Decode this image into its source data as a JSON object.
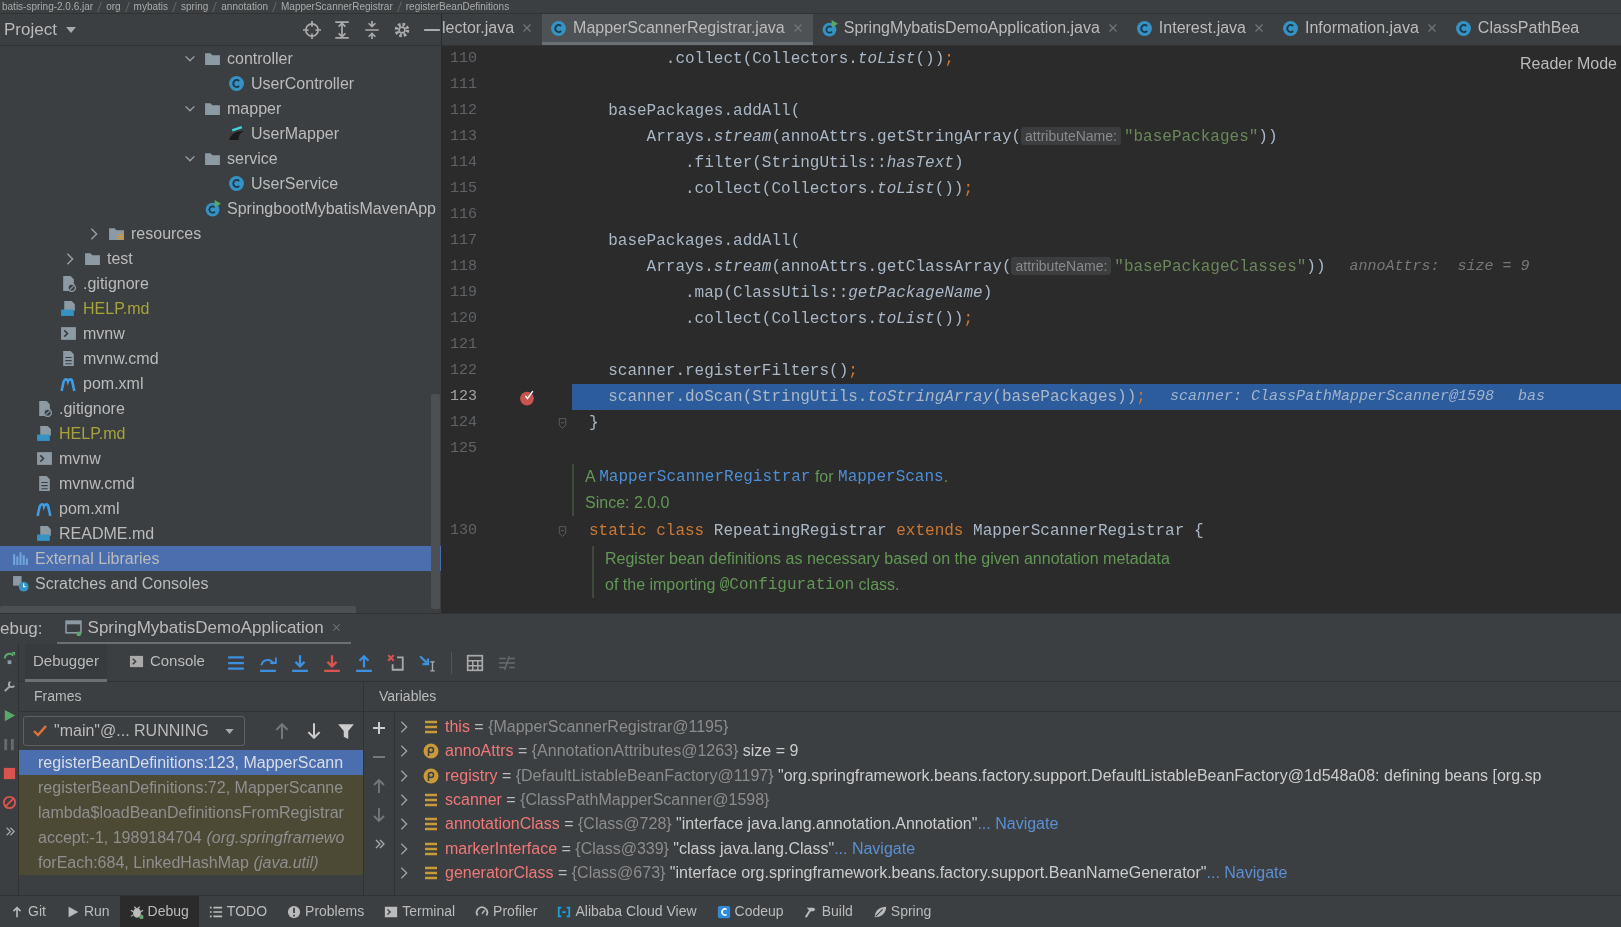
{
  "breadcrumbs": [
    "batis-spring-2.0.6.jar",
    "org",
    "mybatis",
    "spring",
    "annotation",
    "MapperScannerRegistrar",
    "registerBeanDefinitions"
  ],
  "project_panel": {
    "title": "Project",
    "tools": [
      {
        "kind": "locate"
      },
      {
        "kind": "expand"
      },
      {
        "kind": "collapse"
      },
      {
        "kind": "settings"
      },
      {
        "kind": "hide"
      }
    ]
  },
  "tree": [
    {
      "children": [
        {
          "children": [
            {
              "children": [
                {
                  "children": [
                    {
                      "children": [
                        {
                          "children": [
                            {
                              "children": [
                                {
                                  "children": [
                                    {
                                      "label": "controller",
                                      "kind": "folder",
                                      "expanded": true,
                                      "selected": false,
                                      "ignored": false,
                                      "children": [
                                        {
                                          "label": "UserController",
                                          "kind": "class",
                                          "selected": false,
                                          "ignored": false
                                        }
                                      ]
                                    },
                                    {
                                      "label": "mapper",
                                      "kind": "folder",
                                      "expanded": true,
                                      "selected": false,
                                      "ignored": false,
                                      "children": [
                                        {
                                          "label": "UserMapper",
                                          "kind": "mapper",
                                          "selected": false,
                                          "ignored": false
                                        }
                                      ]
                                    },
                                    {
                                      "label": "service",
                                      "kind": "folder",
                                      "expanded": true,
                                      "selected": false,
                                      "ignored": false,
                                      "children": [
                                        {
                                          "label": "UserService",
                                          "kind": "class",
                                          "selected": false,
                                          "ignored": false
                                        }
                                      ]
                                    },
                                    {
                                      "label": "SpringbootMybatisMavenApp",
                                      "kind": "app",
                                      "selected": false,
                                      "ignored": false
                                    }
                                  ]
                                }
                              ]
                            }
                          ]
                        }
                      ]
                    },
                    {
                      "label": "resources",
                      "kind": "resources",
                      "expanded": false,
                      "selected": false,
                      "ignored": false
                    }
                  ]
                },
                {
                  "label": "test",
                  "kind": "folder",
                  "expanded": false,
                  "selected": false,
                  "ignored": false
                }
              ]
            },
            {
              "label": ".gitignore",
              "kind": "ignore",
              "selected": false,
              "ignored": false
            },
            {
              "label": "HELP.md",
              "kind": "markdown",
              "selected": false,
              "ignored": true
            },
            {
              "label": "mvnw",
              "kind": "script",
              "selected": false,
              "ignored": false
            },
            {
              "label": "mvnw.cmd",
              "kind": "text",
              "selected": false,
              "ignored": false
            },
            {
              "label": "pom.xml",
              "kind": "maven",
              "selected": false,
              "ignored": false
            }
          ]
        },
        {
          "label": ".gitignore",
          "kind": "ignore",
          "selected": false,
          "ignored": false
        },
        {
          "label": "HELP.md",
          "kind": "markdown",
          "selected": false,
          "ignored": true
        },
        {
          "label": "mvnw",
          "kind": "script",
          "selected": false,
          "ignored": false
        },
        {
          "label": "mvnw.cmd",
          "kind": "text",
          "selected": false,
          "ignored": false
        },
        {
          "label": "pom.xml",
          "kind": "maven",
          "selected": false,
          "ignored": false
        },
        {
          "label": "README.md",
          "kind": "markdown",
          "selected": false,
          "ignored": false
        }
      ]
    },
    {
      "label": "External Libraries",
      "kind": "libraries",
      "selected": true,
      "ignored": false
    },
    {
      "label": "Scratches and Consoles",
      "kind": "scratches",
      "selected": false,
      "ignored": false
    }
  ],
  "editor_tabs": [
    {
      "label": "lector.java",
      "kind": "cut",
      "selected": false,
      "closable": true
    },
    {
      "label": "MapperScannerRegistrar.java",
      "kind": "class",
      "selected": true,
      "closable": true
    },
    {
      "label": "SpringMybatisDemoApplication.java",
      "kind": "app",
      "selected": false,
      "closable": true
    },
    {
      "label": "Interest.java",
      "kind": "class",
      "selected": false,
      "closable": true
    },
    {
      "label": "Information.java",
      "kind": "class",
      "selected": false,
      "closable": true
    },
    {
      "label": "ClassPathBea",
      "kind": "class",
      "selected": false,
      "closable": false
    }
  ],
  "reader_mode": "Reader Mode",
  "lines": [
    {
      "kind": "code",
      "number": "110",
      "current": false,
      "breakpoint": false,
      "fold": false,
      "tokens": [
        {
          "kind": "plain",
          "text": "        .collect(Collectors."
        },
        {
          "kind": "italic",
          "text": "toList"
        },
        {
          "kind": "plain",
          "text": "())"
        },
        {
          "kind": "keyword",
          "text": ";"
        }
      ]
    },
    {
      "kind": "code",
      "number": "111",
      "current": false,
      "breakpoint": false,
      "fold": false
    },
    {
      "kind": "code",
      "number": "112",
      "current": false,
      "breakpoint": false,
      "fold": false,
      "tokens": [
        {
          "kind": "plain",
          "text": "  basePackages.addAll("
        }
      ]
    },
    {
      "kind": "code",
      "number": "113",
      "current": false,
      "breakpoint": false,
      "fold": false,
      "tokens": [
        {
          "kind": "plain",
          "text": "      Arrays."
        },
        {
          "kind": "italic",
          "text": "stream"
        },
        {
          "kind": "plain",
          "text": "(annoAttrs.getStringArray("
        },
        {
          "kind": "hint",
          "text": "attributeName:"
        },
        {
          "kind": "string",
          "text": "\"basePackages\""
        },
        {
          "kind": "plain",
          "text": "))"
        }
      ]
    },
    {
      "kind": "code",
      "number": "114",
      "current": false,
      "breakpoint": false,
      "fold": false,
      "tokens": [
        {
          "kind": "plain",
          "text": "          .filter(StringUtils::"
        },
        {
          "kind": "italic",
          "text": "hasText"
        },
        {
          "kind": "plain",
          "text": ")"
        }
      ]
    },
    {
      "kind": "code",
      "number": "115",
      "current": false,
      "breakpoint": false,
      "fold": false,
      "tokens": [
        {
          "kind": "plain",
          "text": "          .collect(Collectors."
        },
        {
          "kind": "italic",
          "text": "toList"
        },
        {
          "kind": "plain",
          "text": "())"
        },
        {
          "kind": "keyword",
          "text": ";"
        }
      ]
    },
    {
      "kind": "code",
      "number": "116",
      "current": false,
      "breakpoint": false,
      "fold": false
    },
    {
      "kind": "code",
      "number": "117",
      "current": false,
      "breakpoint": false,
      "fold": false,
      "tokens": [
        {
          "kind": "plain",
          "text": "  basePackages.addAll("
        }
      ]
    },
    {
      "kind": "code",
      "number": "118",
      "current": false,
      "breakpoint": false,
      "fold": false,
      "tokens": [
        {
          "kind": "plain",
          "text": "      Arrays."
        },
        {
          "kind": "italic",
          "text": "stream"
        },
        {
          "kind": "plain",
          "text": "(annoAttrs.getClassArray("
        },
        {
          "kind": "hint",
          "text": "attributeName:"
        },
        {
          "kind": "string",
          "text": "\"basePackageClasses\""
        },
        {
          "kind": "plain",
          "text": "))"
        },
        {
          "kind": "value",
          "text": "annoAttrs:  size = 9"
        }
      ]
    },
    {
      "kind": "code",
      "number": "119",
      "current": false,
      "breakpoint": false,
      "fold": false,
      "tokens": [
        {
          "kind": "plain",
          "text": "          .map(ClassUtils::"
        },
        {
          "kind": "italic",
          "text": "getPackageName"
        },
        {
          "kind": "plain",
          "text": ")"
        }
      ]
    },
    {
      "kind": "code",
      "number": "120",
      "current": false,
      "breakpoint": false,
      "fold": false,
      "tokens": [
        {
          "kind": "plain",
          "text": "          .collect(Collectors."
        },
        {
          "kind": "italic",
          "text": "toList"
        },
        {
          "kind": "plain",
          "text": "())"
        },
        {
          "kind": "keyword",
          "text": ";"
        }
      ]
    },
    {
      "kind": "code",
      "number": "121",
      "current": false,
      "breakpoint": false,
      "fold": false
    },
    {
      "kind": "code",
      "number": "122",
      "current": false,
      "breakpoint": false,
      "fold": false,
      "tokens": [
        {
          "kind": "plain",
          "text": "  scanner.registerFilters()"
        },
        {
          "kind": "keyword",
          "text": ";"
        }
      ]
    },
    {
      "kind": "code",
      "number": "123",
      "current": true,
      "breakpoint": true,
      "fold": false,
      "tokens": [
        {
          "kind": "plain",
          "text": "  scanner.doScan(StringUtils."
        },
        {
          "kind": "italic",
          "text": "toStringArray"
        },
        {
          "kind": "plain",
          "text": "(basePackages))"
        },
        {
          "kind": "keyword",
          "text": ";"
        },
        {
          "kind": "value",
          "text": "scanner: ClassPathMapperScanner@1598"
        },
        {
          "kind": "value",
          "text": "bas"
        }
      ]
    },
    {
      "kind": "code",
      "number": "124",
      "current": false,
      "breakpoint": false,
      "fold": true,
      "tokens": [
        {
          "kind": "plain",
          "text": "}"
        }
      ]
    },
    {
      "kind": "code",
      "number": "125",
      "current": false,
      "breakpoint": false,
      "fold": false
    },
    {
      "kind": "doc",
      "lines": [
        [
          {
            "kind": "doc",
            "text": "A "
          },
          {
            "kind": "link",
            "text": "MapperScannerRegistrar"
          },
          {
            "kind": "doc",
            "text": " for "
          },
          {
            "kind": "link",
            "text": "MapperScans"
          },
          {
            "kind": "doc",
            "text": "."
          }
        ],
        [
          {
            "kind": "doc",
            "text": "Since: 2.0.0"
          }
        ]
      ]
    },
    {
      "kind": "code",
      "number": "130",
      "current": false,
      "breakpoint": false,
      "fold": true,
      "tokens": [
        {
          "kind": "keyword",
          "text": "static class"
        },
        {
          "kind": "plain",
          "text": " RepeatingRegistrar "
        },
        {
          "kind": "keyword",
          "text": "extends"
        },
        {
          "kind": "plain",
          "text": " MapperScannerRegistrar {"
        }
      ]
    },
    {
      "kind": "member-doc",
      "lines": [
        [
          {
            "kind": "doc",
            "text": "Register bean definitions as necessary based on the given annotation metadata"
          }
        ],
        [
          {
            "kind": "doc",
            "text": "of the importing "
          },
          {
            "kind": "code",
            "text": "@Configuration"
          },
          {
            "kind": "doc",
            "text": " class."
          }
        ]
      ]
    }
  ],
  "debug": {
    "label": "ebug:",
    "session_tab": "SpringMybatisDemoApplication",
    "side_actions": [
      {
        "kind": "rerun",
        "disabled": false
      },
      {
        "kind": "modify",
        "disabled": false
      },
      {
        "kind": "resume",
        "disabled": false
      },
      {
        "kind": "pause",
        "disabled": true
      },
      {
        "kind": "stop",
        "disabled": false
      },
      {
        "kind": "mute",
        "disabled": false
      },
      {
        "kind": "more",
        "disabled": false
      }
    ],
    "view_tabs": [
      {
        "label": "Debugger",
        "kind": "debugger",
        "selected": true
      },
      {
        "label": "Console",
        "kind": "console",
        "selected": false
      }
    ],
    "toolbar": [
      {
        "kind": "threads",
        "disabled": false
      },
      {
        "kind": "step-over",
        "disabled": false
      },
      {
        "kind": "step-into",
        "disabled": false
      },
      {
        "kind": "force-step-into",
        "disabled": false
      },
      {
        "kind": "step-out",
        "disabled": false
      },
      {
        "kind": "drop-frame",
        "disabled": false
      },
      {
        "kind": "run-to-cursor",
        "disabled": false
      },
      {
        "kind": "evaluate",
        "disabled": false
      },
      {
        "kind": "trace",
        "disabled": true
      }
    ],
    "frames_title": "Frames",
    "thread": "\"main\"@... RUNNING",
    "frame_tools": [
      {
        "kind": "up",
        "disabled": true
      },
      {
        "kind": "down",
        "disabled": false
      },
      {
        "kind": "filter",
        "disabled": false
      }
    ],
    "frames": [
      {
        "text": "registerBeanDefinitions:123, MapperScann",
        "selected": true,
        "library": false
      },
      {
        "text": "registerBeanDefinitions:72, MapperScanne",
        "selected": false,
        "library": true
      },
      {
        "text": "lambda$loadBeanDefinitionsFromRegistrar",
        "selected": false,
        "library": true
      },
      {
        "text": "accept:-1, 1989184704",
        "package": "(org.springframewo",
        "selected": false,
        "library": true
      },
      {
        "text": "forEach:684, LinkedHashMap",
        "package": "(java.util)",
        "selected": false,
        "library": true
      }
    ],
    "variables_title": "Variables",
    "variable_tools": [
      {
        "kind": "add",
        "disabled": false
      },
      {
        "kind": "remove",
        "disabled": true
      },
      {
        "kind": "up",
        "disabled": true
      },
      {
        "kind": "down",
        "disabled": true
      },
      {
        "kind": "more",
        "disabled": false
      }
    ],
    "variables": [
      {
        "kind": "field",
        "name": "this",
        "equals": "=",
        "ref": "{MapperScannerRegistrar@1195}"
      },
      {
        "kind": "param",
        "name": "annoAttrs",
        "equals": "=",
        "ref": "{AnnotationAttributes@1263}",
        "value": "size = 9"
      },
      {
        "kind": "param",
        "name": "registry",
        "equals": "=",
        "ref": "{DefaultListableBeanFactory@1197}",
        "value": "\"org.springframework.beans.factory.support.DefaultListableBeanFactory@1d548a08: defining beans [org.sp"
      },
      {
        "kind": "field",
        "name": "scanner",
        "equals": "=",
        "ref": "{ClassPathMapperScanner@1598}"
      },
      {
        "kind": "field",
        "name": "annotationClass",
        "equals": "=",
        "ref": "{Class@728}",
        "value": "\"interface java.lang.annotation.Annotation\"",
        "link": "... Navigate"
      },
      {
        "kind": "field",
        "name": "markerInterface",
        "equals": "=",
        "ref": "{Class@339}",
        "value": "\"class java.lang.Class\"",
        "link": "... Navigate"
      },
      {
        "kind": "field",
        "name": "generatorClass",
        "equals": "=",
        "ref": "{Class@673}",
        "value": "\"interface org.springframework.beans.factory.support.BeanNameGenerator\"",
        "link": "... Navigate"
      }
    ]
  },
  "tool_windows": [
    {
      "label": "Git",
      "kind": "git",
      "selected": false
    },
    {
      "label": "Run",
      "kind": "run",
      "selected": false
    },
    {
      "label": "Debug",
      "kind": "debug",
      "selected": true
    },
    {
      "label": "TODO",
      "kind": "todo",
      "selected": false
    },
    {
      "label": "Problems",
      "kind": "problems",
      "selected": false
    },
    {
      "label": "Terminal",
      "kind": "terminal",
      "selected": false
    },
    {
      "label": "Profiler",
      "kind": "profiler",
      "selected": false
    },
    {
      "label": "Alibaba Cloud View",
      "kind": "cloud",
      "selected": false
    },
    {
      "label": "Codeup",
      "kind": "codeup",
      "selected": false
    },
    {
      "label": "Build",
      "kind": "build",
      "selected": false
    },
    {
      "label": "Spring",
      "kind": "spring",
      "selected": false
    }
  ]
}
